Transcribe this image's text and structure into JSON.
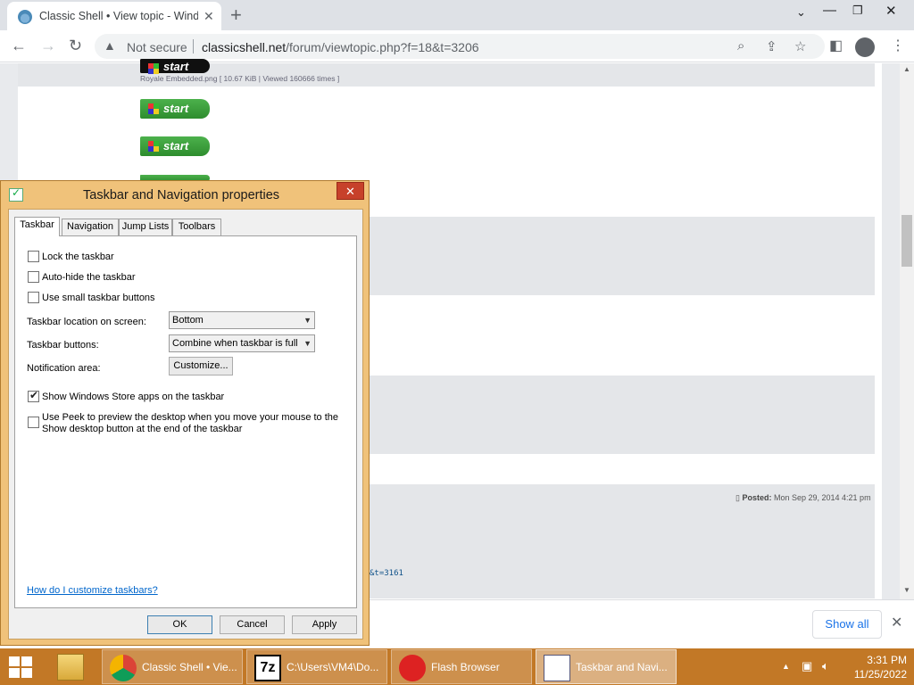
{
  "browser": {
    "tab_title": "Classic Shell • View topic - Windo",
    "security_label": "Not secure",
    "url_host": "classicshell.net",
    "url_path": "/forum/viewtopic.php?f=18&t=3206"
  },
  "page": {
    "attachment_caption": "Royale Embedded.png [ 10.67 KiB | Viewed 160666 times ]",
    "start_label": "start",
    "posted_label": "Posted:",
    "posted_date": "Mon Sep 29, 2014 4:21 pm",
    "link_fragment": "&t=3161"
  },
  "downloads": {
    "show_all": "Show all"
  },
  "dialog": {
    "title": "Taskbar and Navigation properties",
    "tabs": [
      "Taskbar",
      "Navigation",
      "Jump Lists",
      "Toolbars"
    ],
    "options": {
      "lock": {
        "label": "Lock the taskbar",
        "checked": false
      },
      "autohide": {
        "label": "Auto-hide the taskbar",
        "checked": false
      },
      "small": {
        "label": "Use small taskbar buttons",
        "checked": false
      },
      "store": {
        "label": "Show Windows Store apps on the taskbar",
        "checked": true
      },
      "peek": {
        "label": "Use Peek to preview the desktop when you move your mouse to the Show desktop button at the end of the taskbar",
        "checked": false
      }
    },
    "location_label": "Taskbar location on screen:",
    "location_value": "Bottom",
    "buttons_label": "Taskbar buttons:",
    "buttons_value": "Combine when taskbar is full",
    "notification_label": "Notification area:",
    "customize_button": "Customize...",
    "help_link": "How do I customize taskbars?",
    "ok": "OK",
    "cancel": "Cancel",
    "apply": "Apply"
  },
  "taskbar": {
    "items": [
      {
        "label": "Classic Shell • Vie...",
        "icon": "chrome-icon"
      },
      {
        "label": "C:\\Users\\VM4\\Do...",
        "icon": "7zip-icon"
      },
      {
        "label": "Flash Browser",
        "icon": "flash-browser-icon"
      },
      {
        "label": "Taskbar and Navi...",
        "icon": "taskbar-properties-icon"
      }
    ],
    "time": "3:31 PM",
    "date": "11/25/2022"
  },
  "colors": {
    "taskbar": "#c27826",
    "dialog_frame": "#f0c27a",
    "dialog_close": "#c7412a",
    "start_green": "#2e8d2e",
    "link_blue": "#1a73e8"
  }
}
